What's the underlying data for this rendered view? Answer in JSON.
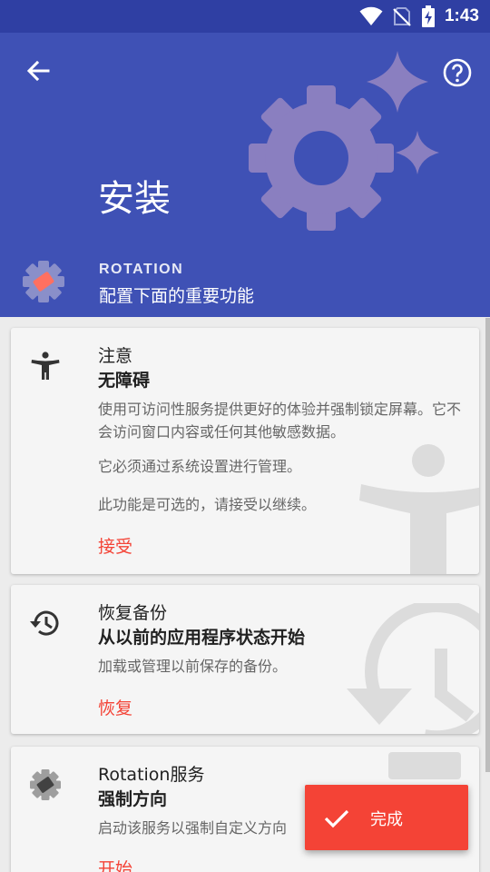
{
  "status_bar": {
    "time": "1:43"
  },
  "header": {
    "title": "安装",
    "app_name": "ROTATION",
    "app_subtitle": "配置下面的重要功能"
  },
  "cards": [
    {
      "title": "注意",
      "subtitle": "无障碍",
      "text1": "使用可访问性服务提供更好的体验并强制锁定屏幕。它不会访问窗口内容或任何其他敏感数据。",
      "text2": "它必须通过系统设置进行管理。",
      "text3": "此功能是可选的，请接受以继续。",
      "action": "接受"
    },
    {
      "title": "恢复备份",
      "subtitle": "从以前的应用程序状态开始",
      "text1": "加载或管理以前保存的备份。",
      "action": "恢复"
    },
    {
      "title": "Rotation服务",
      "subtitle": "强制方向",
      "text1": "启动该服务以强制自定义方向",
      "action": "开始"
    }
  ],
  "fab": {
    "label": "完成"
  },
  "colors": {
    "primary": "#3f51b5",
    "primary_dark": "#2f3fa3",
    "accent": "#f44336",
    "gear_art": "#8a7fc0"
  },
  "icons": {
    "back": "arrow-left-icon",
    "help": "help-circle-icon",
    "accessibility": "accessibility-icon",
    "restore": "history-icon",
    "service": "rotation-app-icon",
    "done": "check-icon"
  }
}
